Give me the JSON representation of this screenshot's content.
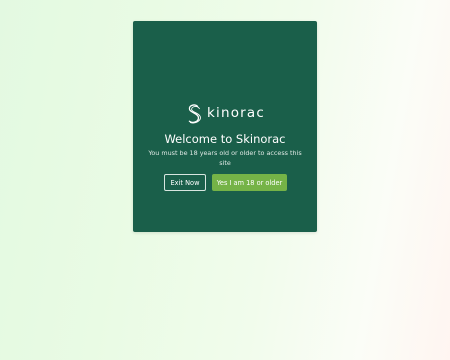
{
  "age_gate": {
    "brand_name": "kinorac",
    "brand_icon": "skinorac-s-logo-icon",
    "title": "Welcome to Skinorac",
    "description": "You must be 18 years old or older to access this site",
    "exit_label": "Exit Now",
    "confirm_label": "Yes I am 18 or older"
  },
  "colors": {
    "modal_bg": "#1a5f4a",
    "confirm_bg": "#75b347",
    "text": "#ffffff"
  }
}
